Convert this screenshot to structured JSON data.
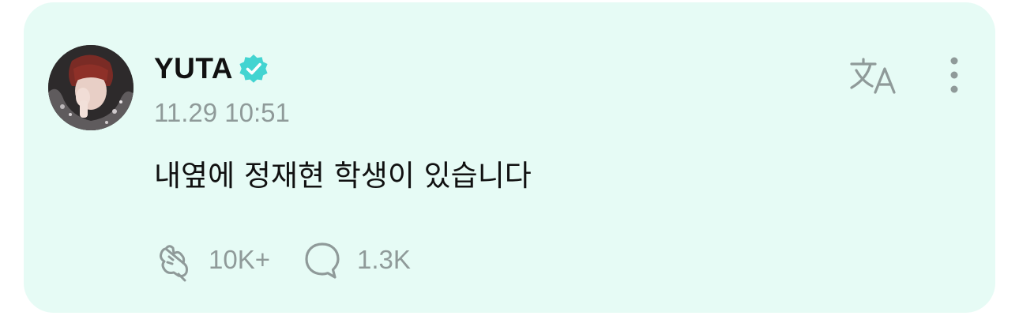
{
  "post": {
    "author": {
      "name": "YUTA",
      "verified": true,
      "avatar_icon": "profile-photo"
    },
    "timestamp": "11.29 10:51",
    "message": "내옆에 정재현 학생이 있습니다",
    "actions": {
      "translate_icon": "translate-icon",
      "more_icon": "more-vertical-icon"
    },
    "stats": {
      "likes_icon": "heart-hands-icon",
      "likes": "10K+",
      "comments_icon": "chat-bubble-icon",
      "comments": "1.3K"
    }
  },
  "colors": {
    "card_background": "#e6fbf5",
    "verified_badge": "#43d4d1",
    "muted_icon": "#8f9a99",
    "text": "#111111"
  }
}
